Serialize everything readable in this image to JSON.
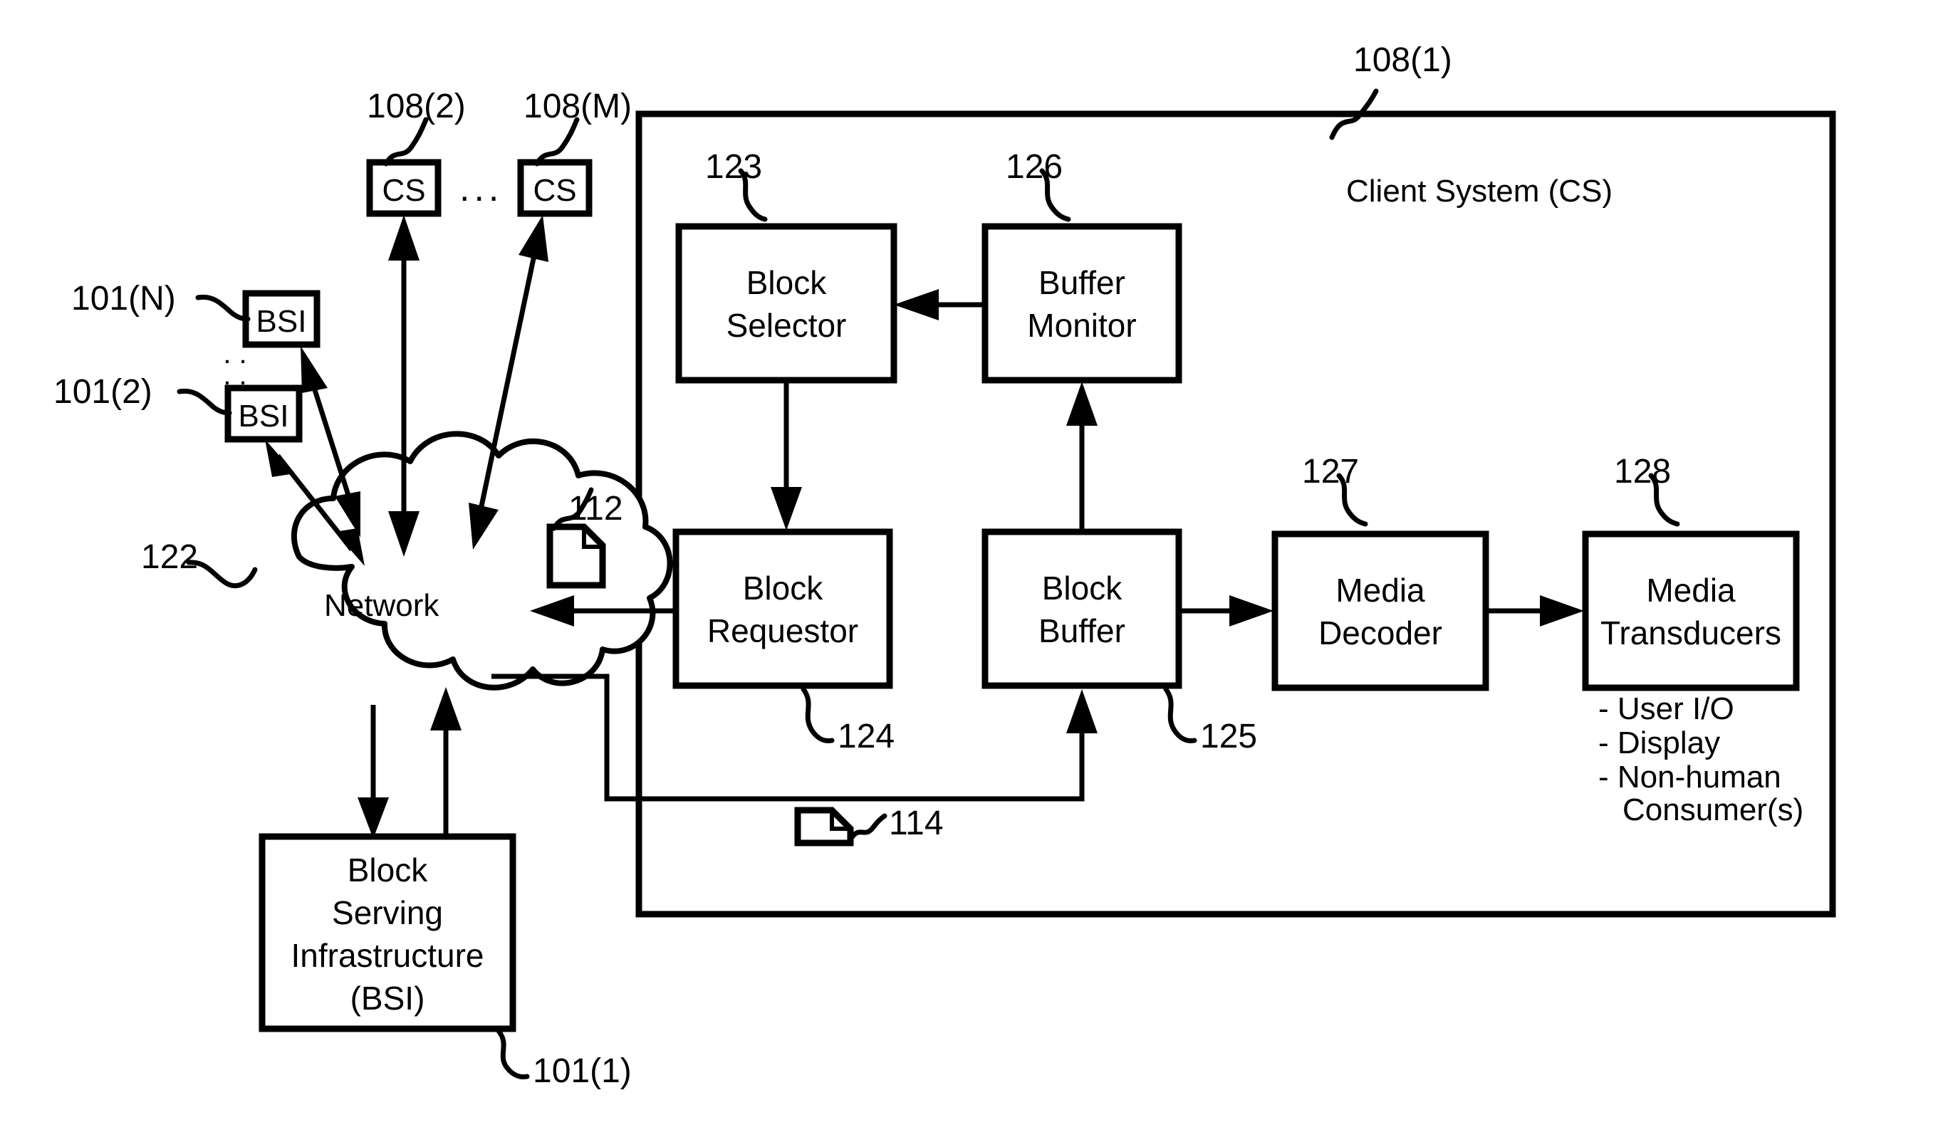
{
  "figure": {
    "title": "Client System block diagram",
    "background_color": "#ffffff",
    "line_color": "#000000"
  },
  "outer_container": {
    "ref": "108(1)",
    "label": "Client System (CS)"
  },
  "client_peers": [
    {
      "ref": "108(2)",
      "label": "CS"
    },
    {
      "ref": "108(M)",
      "label": "CS"
    }
  ],
  "ellipsis": {
    "horizontal": "...",
    "vertical_upper": ". .",
    "vertical_lower": ". ."
  },
  "bsi_peers": [
    {
      "ref": "101(N)",
      "label": "BSI"
    },
    {
      "ref": "101(2)",
      "label": "BSI"
    }
  ],
  "network": {
    "ref": "122",
    "label": "Network"
  },
  "documents": [
    {
      "ref": "112"
    },
    {
      "ref": "114"
    }
  ],
  "block_serving_infrastructure": {
    "ref": "101(1)",
    "lines": [
      "Block",
      "Serving",
      "Infrastructure",
      "(BSI)"
    ]
  },
  "client_blocks": [
    {
      "ref": "123",
      "lines": [
        "Block",
        "Selector"
      ]
    },
    {
      "ref": "126",
      "lines": [
        "Buffer",
        "Monitor"
      ]
    },
    {
      "ref": "124",
      "lines": [
        "Block",
        "Requestor"
      ]
    },
    {
      "ref": "125",
      "lines": [
        "Block",
        "Buffer"
      ]
    },
    {
      "ref": "127",
      "lines": [
        "Media",
        "Decoder"
      ]
    },
    {
      "ref": "128",
      "lines": [
        "Media",
        "Transducers"
      ]
    }
  ],
  "transducer_list": [
    "- User I/O",
    "- Display",
    "- Non-human",
    "Consumer(s)"
  ]
}
